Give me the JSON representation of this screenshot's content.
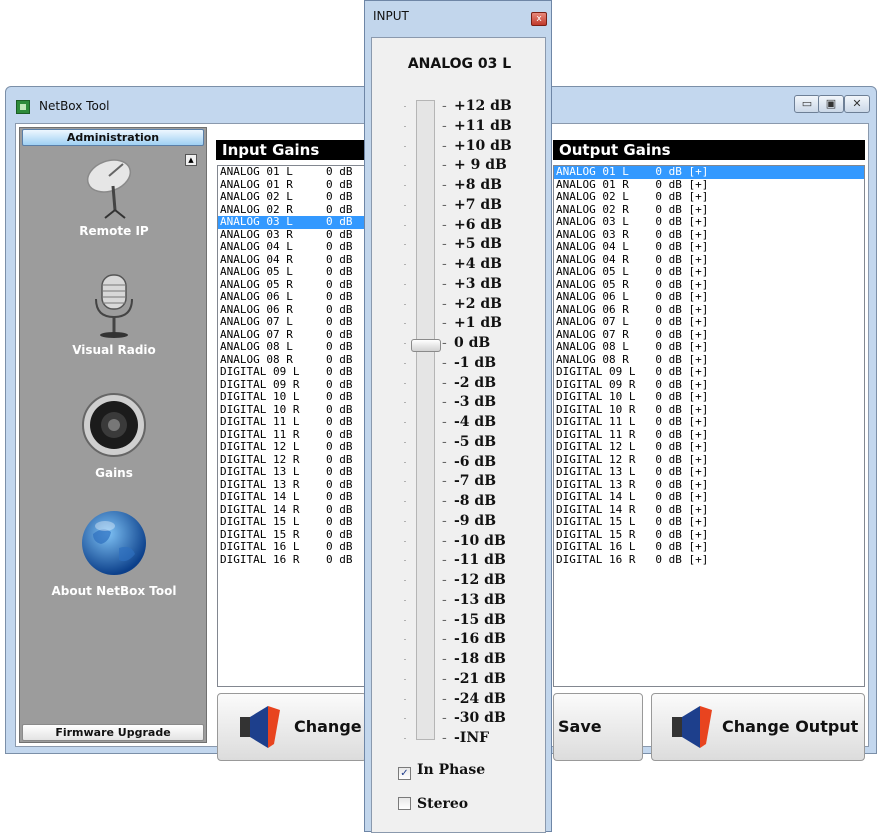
{
  "window": {
    "title": "NetBox Tool",
    "controls": {
      "minimize": "▭",
      "maximize": "▣",
      "close": "✕"
    }
  },
  "sidebar": {
    "header": "Administration",
    "footer": "Firmware Upgrade",
    "items": [
      {
        "label": "Remote IP",
        "icon": "satellite-dish-icon"
      },
      {
        "label": "Visual Radio",
        "icon": "microphone-icon"
      },
      {
        "label": "Gains",
        "icon": "speaker-icon"
      },
      {
        "label": "About NetBox Tool",
        "icon": "globe-icon"
      }
    ]
  },
  "input_gains": {
    "title": "Input Gains",
    "rows": [
      "ANALOG 01 L     0 dB",
      "ANALOG 01 R     0 dB",
      "ANALOG 02 L     0 dB",
      "ANALOG 02 R     0 dB",
      "ANALOG 03 L     0 dB",
      "ANALOG 03 R     0 dB",
      "ANALOG 04 L     0 dB",
      "ANALOG 04 R     0 dB",
      "ANALOG 05 L     0 dB",
      "ANALOG 05 R     0 dB",
      "ANALOG 06 L     0 dB",
      "ANALOG 06 R     0 dB",
      "ANALOG 07 L     0 dB",
      "ANALOG 07 R     0 dB",
      "ANALOG 08 L     0 dB",
      "ANALOG 08 R     0 dB",
      "DIGITAL 09 L    0 dB",
      "DIGITAL 09 R    0 dB",
      "DIGITAL 10 L    0 dB",
      "DIGITAL 10 R    0 dB",
      "DIGITAL 11 L    0 dB",
      "DIGITAL 11 R    0 dB",
      "DIGITAL 12 L    0 dB",
      "DIGITAL 12 R    0 dB",
      "DIGITAL 13 L    0 dB",
      "DIGITAL 13 R    0 dB",
      "DIGITAL 14 L    0 dB",
      "DIGITAL 14 R    0 dB",
      "DIGITAL 15 L    0 dB",
      "DIGITAL 15 R    0 dB",
      "DIGITAL 16 L    0 dB",
      "DIGITAL 16 R    0 dB"
    ],
    "selected_index": 4
  },
  "output_gains": {
    "title": "Output Gains",
    "rows": [
      "ANALOG 01 L    0 dB [+]",
      "ANALOG 01 R    0 dB [+]",
      "ANALOG 02 L    0 dB [+]",
      "ANALOG 02 R    0 dB [+]",
      "ANALOG 03 L    0 dB [+]",
      "ANALOG 03 R    0 dB [+]",
      "ANALOG 04 L    0 dB [+]",
      "ANALOG 04 R    0 dB [+]",
      "ANALOG 05 L    0 dB [+]",
      "ANALOG 05 R    0 dB [+]",
      "ANALOG 06 L    0 dB [+]",
      "ANALOG 06 R    0 dB [+]",
      "ANALOG 07 L    0 dB [+]",
      "ANALOG 07 R    0 dB [+]",
      "ANALOG 08 L    0 dB [+]",
      "ANALOG 08 R    0 dB [+]",
      "DIGITAL 09 L   0 dB [+]",
      "DIGITAL 09 R   0 dB [+]",
      "DIGITAL 10 L   0 dB [+]",
      "DIGITAL 10 R   0 dB [+]",
      "DIGITAL 11 L   0 dB [+]",
      "DIGITAL 11 R   0 dB [+]",
      "DIGITAL 12 L   0 dB [+]",
      "DIGITAL 12 R   0 dB [+]",
      "DIGITAL 13 L   0 dB [+]",
      "DIGITAL 13 R   0 dB [+]",
      "DIGITAL 14 L   0 dB [+]",
      "DIGITAL 14 R   0 dB [+]",
      "DIGITAL 15 L   0 dB [+]",
      "DIGITAL 15 R   0 dB [+]",
      "DIGITAL 16 L   0 dB [+]",
      "DIGITAL 16 R   0 dB [+]"
    ],
    "selected_index": 0
  },
  "buttons": {
    "change_input": "Change",
    "save": "Save",
    "change_output": "Change Output",
    "icon": "speaker-horn-icon"
  },
  "input_dialog": {
    "title": "INPUT",
    "close": "x",
    "channel": "ANALOG 03 L",
    "levels": [
      "+12 dB",
      "+11 dB",
      "+10 dB",
      "+ 9 dB",
      "+8 dB",
      "+7 dB",
      "+6 dB",
      "+5 dB",
      "+4 dB",
      "+3 dB",
      "+2 dB",
      "+1 dB",
      "0 dB",
      "-1 dB",
      "-2 dB",
      "-3 dB",
      "-4 dB",
      "-5 dB",
      "-6 dB",
      "-7 dB",
      "-8 dB",
      "-9 dB",
      "-10 dB",
      "-11 dB",
      "-12 dB",
      "-13 dB",
      "-15 dB",
      "-16 dB",
      "-18 dB",
      "-21 dB",
      "-24 dB",
      "-30 dB",
      "-INF"
    ],
    "current_level": "0 dB",
    "in_phase": {
      "label": "In Phase",
      "checked": true
    },
    "stereo": {
      "label": "Stereo",
      "checked": false
    }
  },
  "colors": {
    "selection": "#3399ff",
    "frame": "#c3d7ee",
    "speaker_cone": "#e8441f"
  }
}
